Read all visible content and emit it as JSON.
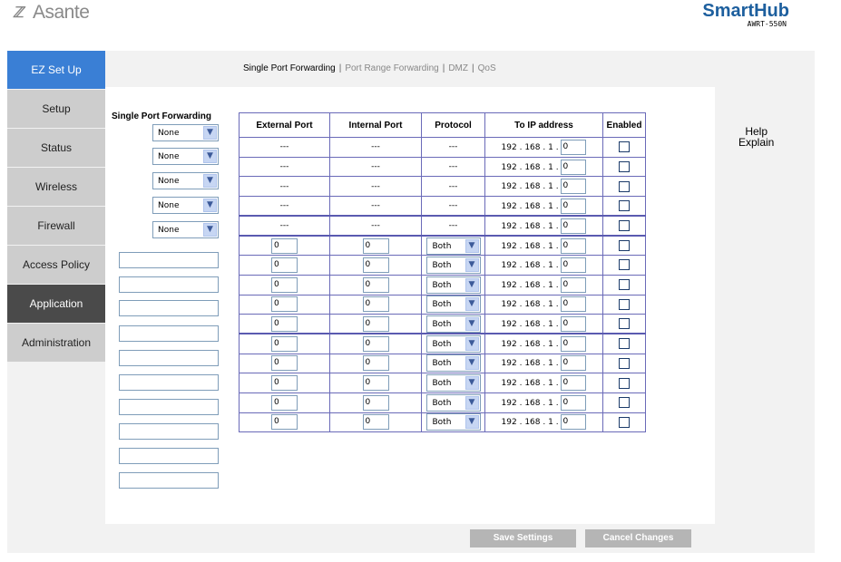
{
  "brand": {
    "logo": "Asante",
    "product": "SmartHub",
    "model": "AWRT-550N"
  },
  "sidebar": {
    "items": [
      {
        "label": "EZ Set Up"
      },
      {
        "label": "Setup"
      },
      {
        "label": "Status"
      },
      {
        "label": "Wireless"
      },
      {
        "label": "Firewall"
      },
      {
        "label": "Access Policy"
      },
      {
        "label": "Application"
      },
      {
        "label": "Administration"
      }
    ]
  },
  "subnav": {
    "items": [
      "Single Port Forwarding",
      "Port Range Forwarding",
      "DMZ",
      "QoS"
    ],
    "separator": "|"
  },
  "section": {
    "title": "Single Port Forwarding"
  },
  "apps": {
    "selects": [
      "None",
      "None",
      "None",
      "None",
      "None"
    ],
    "text_fields": [
      "",
      "",
      "",
      "",
      "",
      "",
      "",
      "",
      "",
      "",
      ""
    ]
  },
  "table": {
    "headers": [
      "External Port",
      "Internal Port",
      "Protocol",
      "To IP address",
      "Enabled"
    ],
    "dash": "---",
    "ip_prefix": [
      "192",
      "168",
      "1"
    ],
    "ip_last": "0",
    "port_default": "0",
    "protocol_default": "Both"
  },
  "help": {
    "line1": "Help",
    "line2": "Explain"
  },
  "buttons": {
    "save": "Save Settings",
    "cancel": "Cancel Changes"
  },
  "colors": {
    "accent": "#3a7fd5",
    "active_nav": "#4a4a4a",
    "table_border": "#6a6ab8",
    "brand": "#1d5f9e"
  }
}
